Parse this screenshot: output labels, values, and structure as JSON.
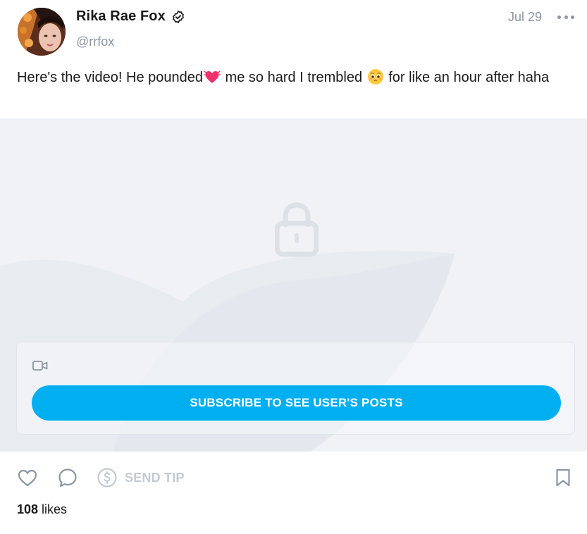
{
  "author": {
    "display_name": "Rika Rae Fox",
    "handle": "@rrfox",
    "verified_icon": "verified-badge-icon"
  },
  "post": {
    "date": "Jul 29",
    "text_part1": "Here's the video! He pounded",
    "emoji1": "heart-with-lines-icon",
    "text_part2": " me so hard I trembled ",
    "emoji2": "pleading-face-icon",
    "text_part3": " for like an hour after haha"
  },
  "media": {
    "locked_icon": "lock-icon",
    "media_type_icon": "video-camera-icon",
    "subscribe_label": "SUBSCRIBE TO SEE USER'S POSTS"
  },
  "actions": {
    "like_icon": "heart-icon",
    "comment_icon": "comment-icon",
    "tip_icon": "dollar-circle-icon",
    "tip_label": "SEND TIP",
    "bookmark_icon": "bookmark-icon"
  },
  "likes": {
    "count": "108",
    "label": " likes"
  },
  "colors": {
    "accent": "#00aff0",
    "muted": "#8a96a3",
    "media_bg": "#f0f2f6"
  }
}
